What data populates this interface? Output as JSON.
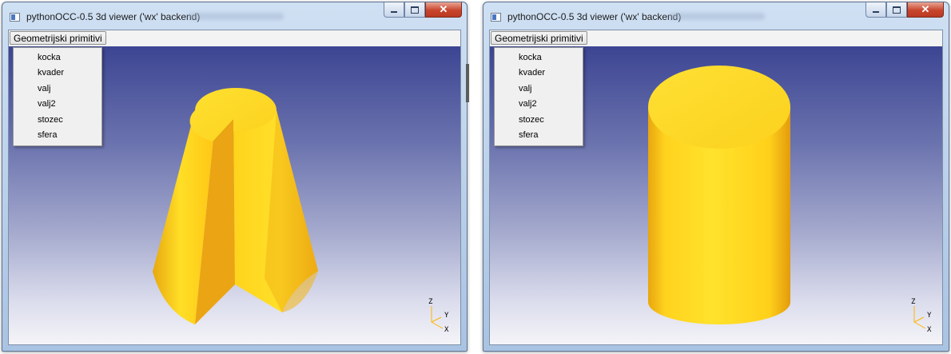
{
  "windows": [
    {
      "title": "pythonOCC-0.5 3d viewer ('wx' backend)",
      "menu": {
        "title": "Geometrijski primitivi",
        "items": [
          "kocka",
          "kvader",
          "valj",
          "valj2",
          "stozec",
          "sfera"
        ]
      },
      "shape": "cone-with-wedge-cut",
      "triad": {
        "z": "Z",
        "y": "Y",
        "x": "X"
      }
    },
    {
      "title": "pythonOCC-0.5 3d viewer ('wx' backend)",
      "menu": {
        "title": "Geometrijski primitivi",
        "items": [
          "kocka",
          "kvader",
          "valj",
          "valj2",
          "stozec",
          "sfera"
        ]
      },
      "shape": "cylinder",
      "triad": {
        "z": "Z",
        "y": "Y",
        "x": "X"
      }
    }
  ],
  "window_controls": {
    "minimize": "–",
    "maximize": "□",
    "close": "✕"
  },
  "colors": {
    "shape_yellow": "#ffd21c",
    "shape_shadow": "#e39d10",
    "viewport_top": "#3c4592",
    "viewport_bottom": "#f4f4f8",
    "close_button": "#c8452c"
  }
}
